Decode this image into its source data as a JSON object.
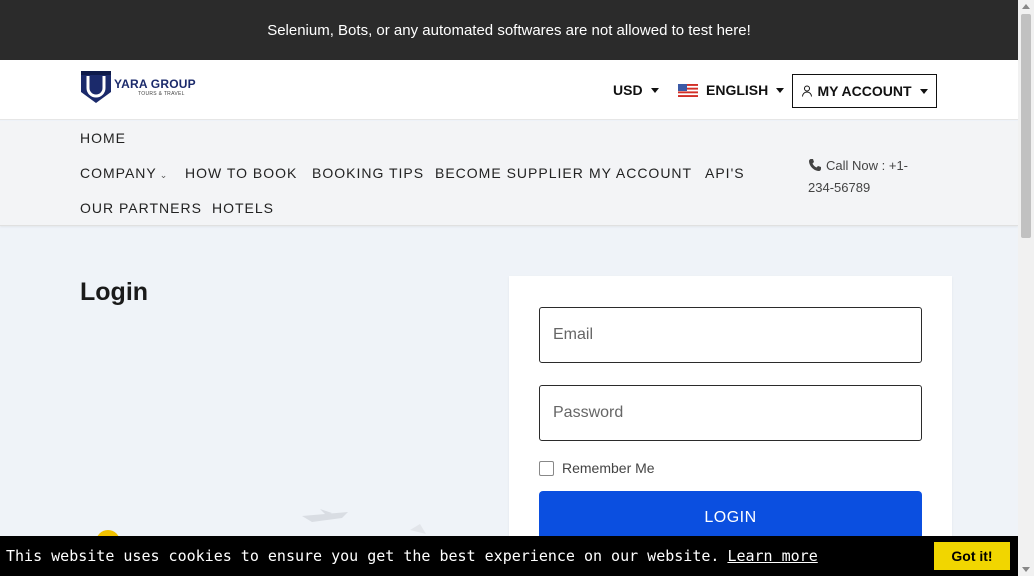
{
  "banner": {
    "text": "Selenium, Bots, or any automated softwares are not allowed to test here!"
  },
  "header": {
    "logo": {
      "name": "YARA GROUP",
      "tagline": "TOURS & TRAVEL",
      "icon": "yara-logo-icon"
    },
    "currency": "USD",
    "language": {
      "label": "ENGLISH",
      "icon": "us-flag-icon"
    },
    "account": {
      "label": "MY ACCOUNT",
      "icon": "user-icon"
    }
  },
  "nav": {
    "items": [
      {
        "label": "HOME"
      },
      {
        "label": "COMPANY",
        "icon": "chevron-down-icon"
      },
      {
        "label": "HOW TO BOOK"
      },
      {
        "label": "BOOKING TIPS"
      },
      {
        "label": "BECOME SUPPLIER"
      },
      {
        "label": "MY ACCOUNT"
      },
      {
        "label": "API'S"
      },
      {
        "label": "OUR PARTNERS"
      },
      {
        "label": "HOTELS"
      }
    ],
    "call": {
      "text": "Call Now : +1-234-56789",
      "icon": "phone-icon"
    }
  },
  "page": {
    "title": "Login"
  },
  "login_form": {
    "email_placeholder": "Email",
    "password_placeholder": "Password",
    "remember_label": "Remember Me",
    "remember_checked": false,
    "submit_label": "LOGIN",
    "accent_color": "#0b4fe0"
  },
  "cookie": {
    "text": "This website uses cookies to ensure you get the best experience on our website.",
    "link": "Learn more",
    "button": "Got it!",
    "button_color": "#f1d600"
  }
}
